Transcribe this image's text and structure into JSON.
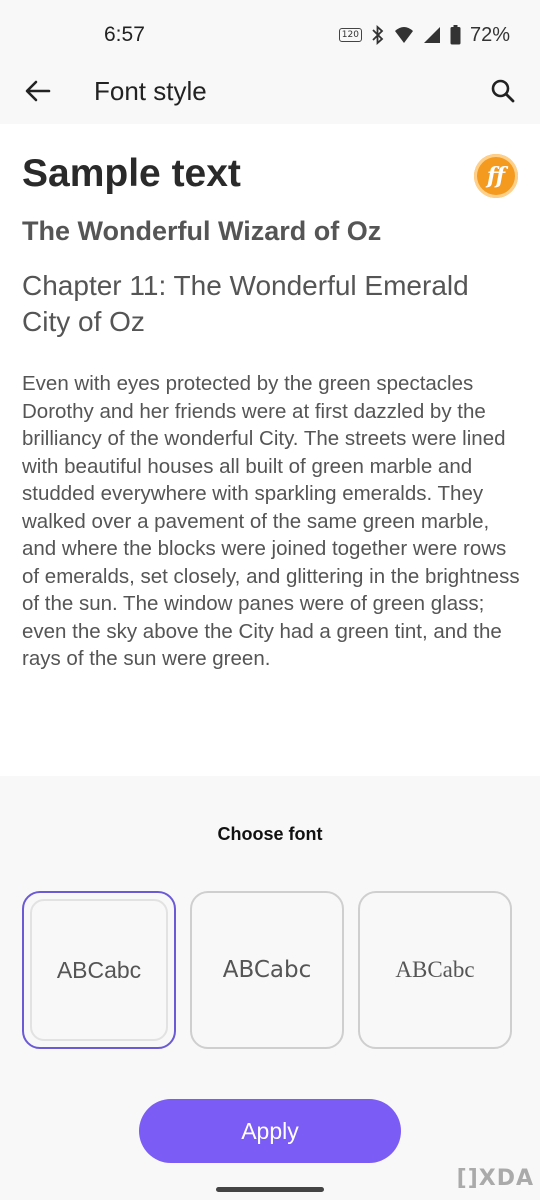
{
  "status_bar": {
    "time": "6:57",
    "hz": "120",
    "battery": "72%"
  },
  "app_bar": {
    "title": "Font style"
  },
  "preview": {
    "heading": "Sample text",
    "logo_text": "ff",
    "book_title": "The Wonderful Wizard of Oz",
    "chapter_title": "Chapter 11: The Wonderful Emerald City of Oz",
    "body": "Even with eyes protected by the green spectacles Dorothy and her friends were at first dazzled by the brilliancy of the wonderful City. The streets were lined with beautiful houses all built of green marble and studded everywhere with sparkling emeralds. They walked over a pavement of the same green marble, and where the blocks were joined together were rows of emeralds, set closely, and glittering in the brightness of the sun. The window panes were of green glass; even the sky above the City had a green tint, and the rays of the sun were green."
  },
  "font_picker": {
    "label": "Choose font",
    "options": [
      {
        "sample": "ABCabc",
        "selected": true
      },
      {
        "sample": "ABCabc",
        "selected": false
      },
      {
        "sample": "ABCabc",
        "selected": false
      }
    ]
  },
  "apply_label": "Apply",
  "watermark": "[]XDA",
  "colors": {
    "accent": "#7b5cf5",
    "selected_border": "#6b5ad6",
    "logo": "#f39a1f"
  },
  "icons": [
    "back-arrow-icon",
    "search-icon",
    "bluetooth-icon",
    "wifi-icon",
    "signal-icon",
    "battery-icon",
    "refresh-rate-icon"
  ]
}
